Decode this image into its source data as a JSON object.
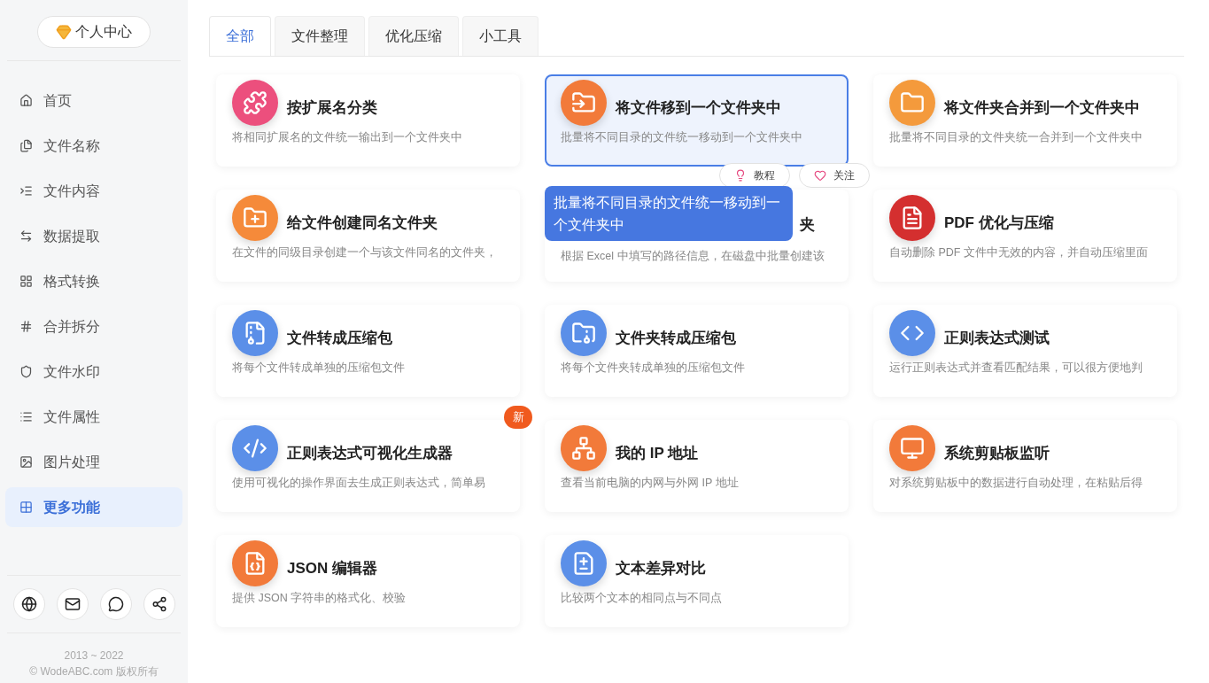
{
  "sidebar": {
    "profile_button": "个人中心",
    "items": [
      {
        "label": "首页",
        "selected": false
      },
      {
        "label": "文件名称",
        "selected": false
      },
      {
        "label": "文件内容",
        "selected": false
      },
      {
        "label": "数据提取",
        "selected": false
      },
      {
        "label": "格式转换",
        "selected": false
      },
      {
        "label": "合并拆分",
        "selected": false
      },
      {
        "label": "文件水印",
        "selected": false
      },
      {
        "label": "文件属性",
        "selected": false
      },
      {
        "label": "图片处理",
        "selected": false
      },
      {
        "label": "更多功能",
        "selected": true
      }
    ],
    "footer": {
      "years": "2013 ~ 2022",
      "copyright": "© WodeABC.com 版权所有"
    }
  },
  "tabs": [
    {
      "label": "全部",
      "selected": true
    },
    {
      "label": "文件整理",
      "selected": false
    },
    {
      "label": "优化压缩",
      "selected": false
    },
    {
      "label": "小工具",
      "selected": false
    }
  ],
  "cards": [
    {
      "title": "按扩展名分类",
      "description": "将相同扩展名的文件统一输出到一个文件夹中",
      "selected": false
    },
    {
      "title": "将文件移到一个文件夹中",
      "description": "批量将不同目录的文件统一移动到一个文件夹中",
      "selected": true,
      "actions": [
        "教程",
        "关注"
      ]
    },
    {
      "title": "将文件夹合并到一个文件夹中",
      "description": "批量将不同目录的文件夹统一合并到一个文件夹中",
      "selected": false
    },
    {
      "title": "给文件创建同名文件夹",
      "description": "在文件的同级目录创建一个与该文件同名的文件夹，",
      "selected": false
    },
    {
      "title": "夹",
      "title_covered": true,
      "description": "根据 Excel 中填写的路径信息，在磁盘中批量创建该",
      "selected": false
    },
    {
      "title": "PDF 优化与压缩",
      "description": "自动删除 PDF 文件中无效的内容，并自动压缩里面",
      "selected": false
    },
    {
      "title": "文件转成压缩包",
      "description": "将每个文件转成单独的压缩包文件",
      "selected": false
    },
    {
      "title": "文件夹转成压缩包",
      "description": "将每个文件夹转成单独的压缩包文件",
      "selected": false
    },
    {
      "title": "正则表达式测试",
      "description": "运行正则表达式并查看匹配结果，可以很方便地判",
      "selected": false
    },
    {
      "title": "正则表达式可视化生成器",
      "description": "使用可视化的操作界面去生成正则表达式，简单易",
      "selected": false,
      "badge": "新"
    },
    {
      "title": "我的 IP 地址",
      "description": "查看当前电脑的内网与外网 IP 地址",
      "selected": false
    },
    {
      "title": "系统剪贴板监听",
      "description": "对系统剪贴板中的数据进行自动处理，在粘贴后得",
      "selected": false
    },
    {
      "title": "JSON 编辑器",
      "description": "提供 JSON 字符串的格式化、校验",
      "selected": false
    },
    {
      "title": "文本差异对比",
      "description": "比较两个文本的相同点与不同点",
      "selected": false
    }
  ],
  "tooltip": "批量将不同目录的文件统一移动到一个文件夹中"
}
